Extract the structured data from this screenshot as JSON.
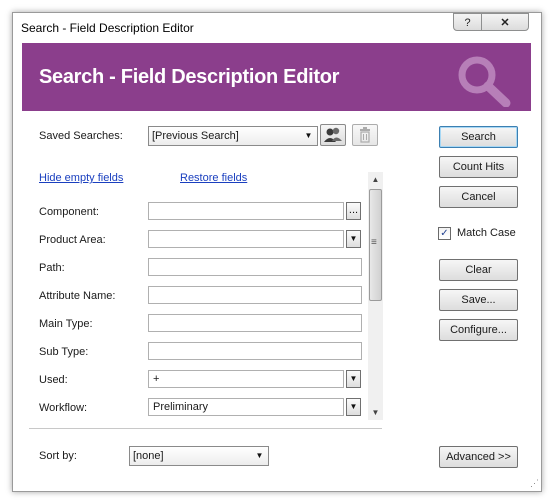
{
  "window": {
    "title": "Search - Field Description Editor",
    "help_glyph": "?",
    "close_glyph": "✕"
  },
  "banner": {
    "title": "Search - Field Description Editor",
    "icon": "search-magnifier-icon",
    "color": "#8b3e8c"
  },
  "saved_searches": {
    "label": "Saved Searches:",
    "value": "[Previous Search]"
  },
  "links": {
    "hide_empty": "Hide empty fields",
    "restore": "Restore fields"
  },
  "fields": {
    "component": {
      "label": "Component:",
      "value": "",
      "browse": "..."
    },
    "product_area": {
      "label": "Product Area:",
      "value": ""
    },
    "path": {
      "label": "Path:",
      "value": ""
    },
    "attribute_name": {
      "label": "Attribute Name:",
      "value": ""
    },
    "main_type": {
      "label": "Main Type:",
      "value": ""
    },
    "sub_type": {
      "label": "Sub Type:",
      "value": ""
    },
    "used": {
      "label": "Used:",
      "value": "+"
    },
    "workflow": {
      "label": "Workflow:",
      "value": "Preliminary"
    }
  },
  "sort_by": {
    "label": "Sort by:",
    "value": "[none]"
  },
  "buttons": {
    "search": "Search",
    "count_hits": "Count Hits",
    "cancel": "Cancel",
    "clear": "Clear",
    "save": "Save...",
    "configure": "Configure...",
    "advanced": "Advanced >>"
  },
  "match_case": {
    "label": "Match Case",
    "checked": true,
    "check_glyph": "✓"
  },
  "glyphs": {
    "dropdown": "▼",
    "scroll_up": "▲",
    "scroll_down": "▼",
    "grip": "≡"
  }
}
